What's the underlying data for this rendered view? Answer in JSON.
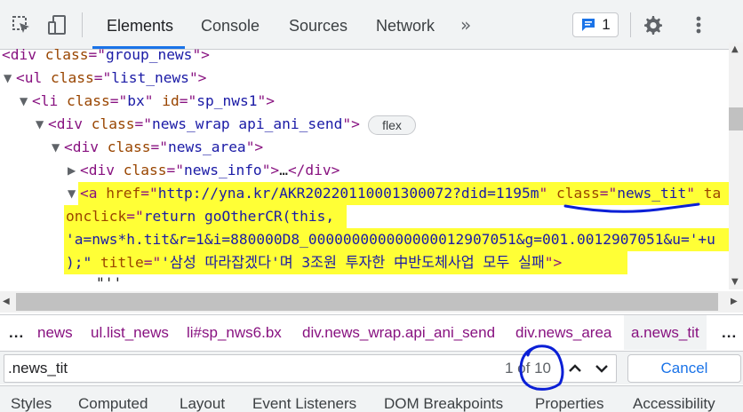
{
  "toolbar": {
    "tabs": [
      "Elements",
      "Console",
      "Sources",
      "Network"
    ],
    "more_tabs": "»",
    "issues_count": "1",
    "icons": [
      "inspect-cursor-icon",
      "device-toggle-icon",
      "more-tabs-icon",
      "message-icon",
      "gear-icon",
      "kebab-menu-icon"
    ],
    "accent_color": "#1a73e8"
  },
  "code": {
    "l1": {
      "open": "<div ",
      "attr": "class",
      "eq": "=\"",
      "val": "group_news",
      "close": "\">"
    },
    "l2": {
      "open": "<ul ",
      "attr": "class",
      "eq": "=\"",
      "val": "list_news",
      "close": "\">"
    },
    "l3": {
      "open": "<li ",
      "attr1": "class",
      "eq1": "=\"",
      "val1": "bx",
      "mid": "\" ",
      "attr2": "id",
      "eq2": "=\"",
      "val2": "sp_nws1",
      "close": "\">"
    },
    "l4": {
      "open": "<div ",
      "attr": "class",
      "eq": "=\"",
      "val": "news_wrap api_ani_send",
      "close": "\">",
      "badge": "flex"
    },
    "l5": {
      "open": "<div ",
      "attr": "class",
      "eq": "=\"",
      "val": "news_area",
      "close": "\">"
    },
    "l6": {
      "open": "<div ",
      "attr": "class",
      "eq": "=\"",
      "val": "news_info",
      "close": "\">",
      "ellipsis": "…",
      "end": "</div>"
    },
    "l7": {
      "open": "<a ",
      "attr1": "href",
      "eq1": "=\"",
      "val1": "http://yna.kr/AKR20220110001300072?did=1195m",
      "mid1": "\" ",
      "attr2": "class",
      "eq2": "=\"",
      "val2": "news_tit",
      "mid2": "\" ",
      "attr3": "ta"
    },
    "l8": {
      "attr": "onclick",
      "eq": "=\"",
      "val": "return goOtherCR(this,"
    },
    "l9": {
      "val": "'a=nws*h.tit&r=1&i=880000D8_000000000000000012907051&g=001.0012907051&u='+u"
    },
    "l10": {
      "val": ");\" ",
      "attr": "title",
      "eq": "=\"",
      "val2": "'삼성 따라잡겠다'며 3조원 투자한 中반도체사업 모두 실패",
      "close": "\">"
    },
    "l11": {
      "val": "\"''"
    },
    "highlight_color": "#ffff36"
  },
  "breadcrumbs": [
    "news",
    "ul.list_news",
    "li#sp_nws6.bx",
    "div.news_wrap.api_ani_send",
    "div.news_area",
    "a.news_tit"
  ],
  "breadcrumb_more": "...",
  "search": {
    "value": ".news_tit",
    "match_status": "1 of 10",
    "cancel_label": "Cancel"
  },
  "bottom_tabs": [
    "Styles",
    "Computed",
    "Layout",
    "Event Listeners",
    "DOM Breakpoints",
    "Properties",
    "Accessibility"
  ],
  "annotation_color": "#0a1fd6"
}
